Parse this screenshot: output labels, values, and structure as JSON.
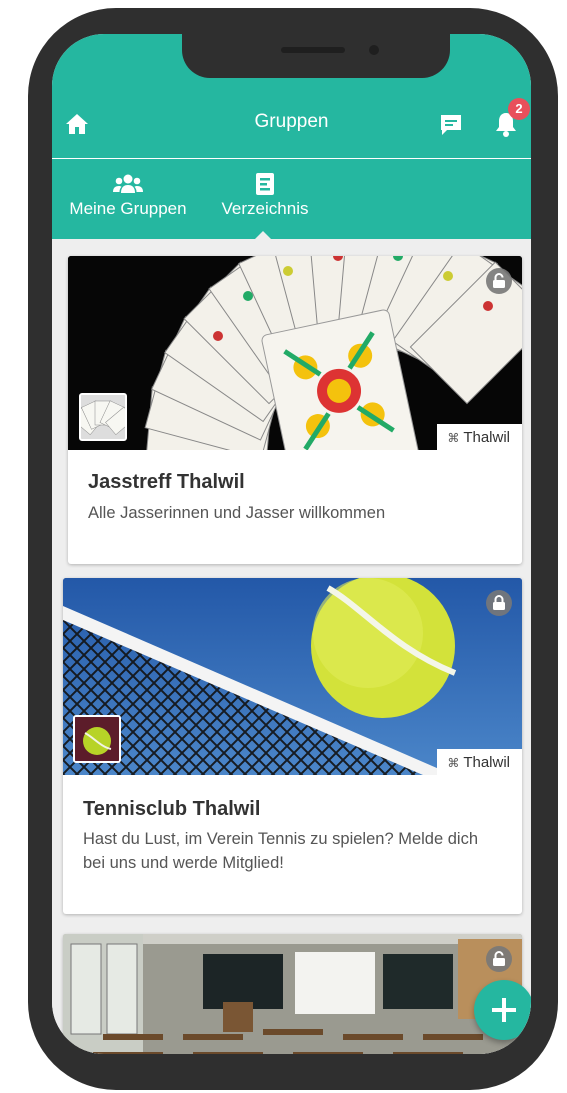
{
  "appbar": {
    "title": "Gruppen",
    "home_icon": "home-icon",
    "chat_icon": "chat-icon",
    "bell_icon": "bell-icon",
    "notification_count": "2"
  },
  "tabs": [
    {
      "label": "Meine Gruppen",
      "icon": "users-icon"
    },
    {
      "label": "Verzeichnis",
      "icon": "directory-icon",
      "active": true
    }
  ],
  "groups": [
    {
      "title": "Jasstreff Thalwil",
      "description": "Alle Jasserinnen und Jasser willkommen",
      "location": "Thalwil",
      "lock": "unlocked"
    },
    {
      "title": "Tennisclub Thalwil",
      "description": "Hast du Lust, im Verein Tennis zu spielen? Melde dich bei uns und werde Mitglied!",
      "location": "Thalwil",
      "lock": "locked"
    },
    {
      "title": "",
      "description": "",
      "location": "",
      "lock": "unlocked"
    }
  ],
  "colors": {
    "accent": "#25b7a0",
    "badge": "#e8505b",
    "background": "#eeeeee"
  },
  "fab": {
    "icon": "plus-icon"
  }
}
